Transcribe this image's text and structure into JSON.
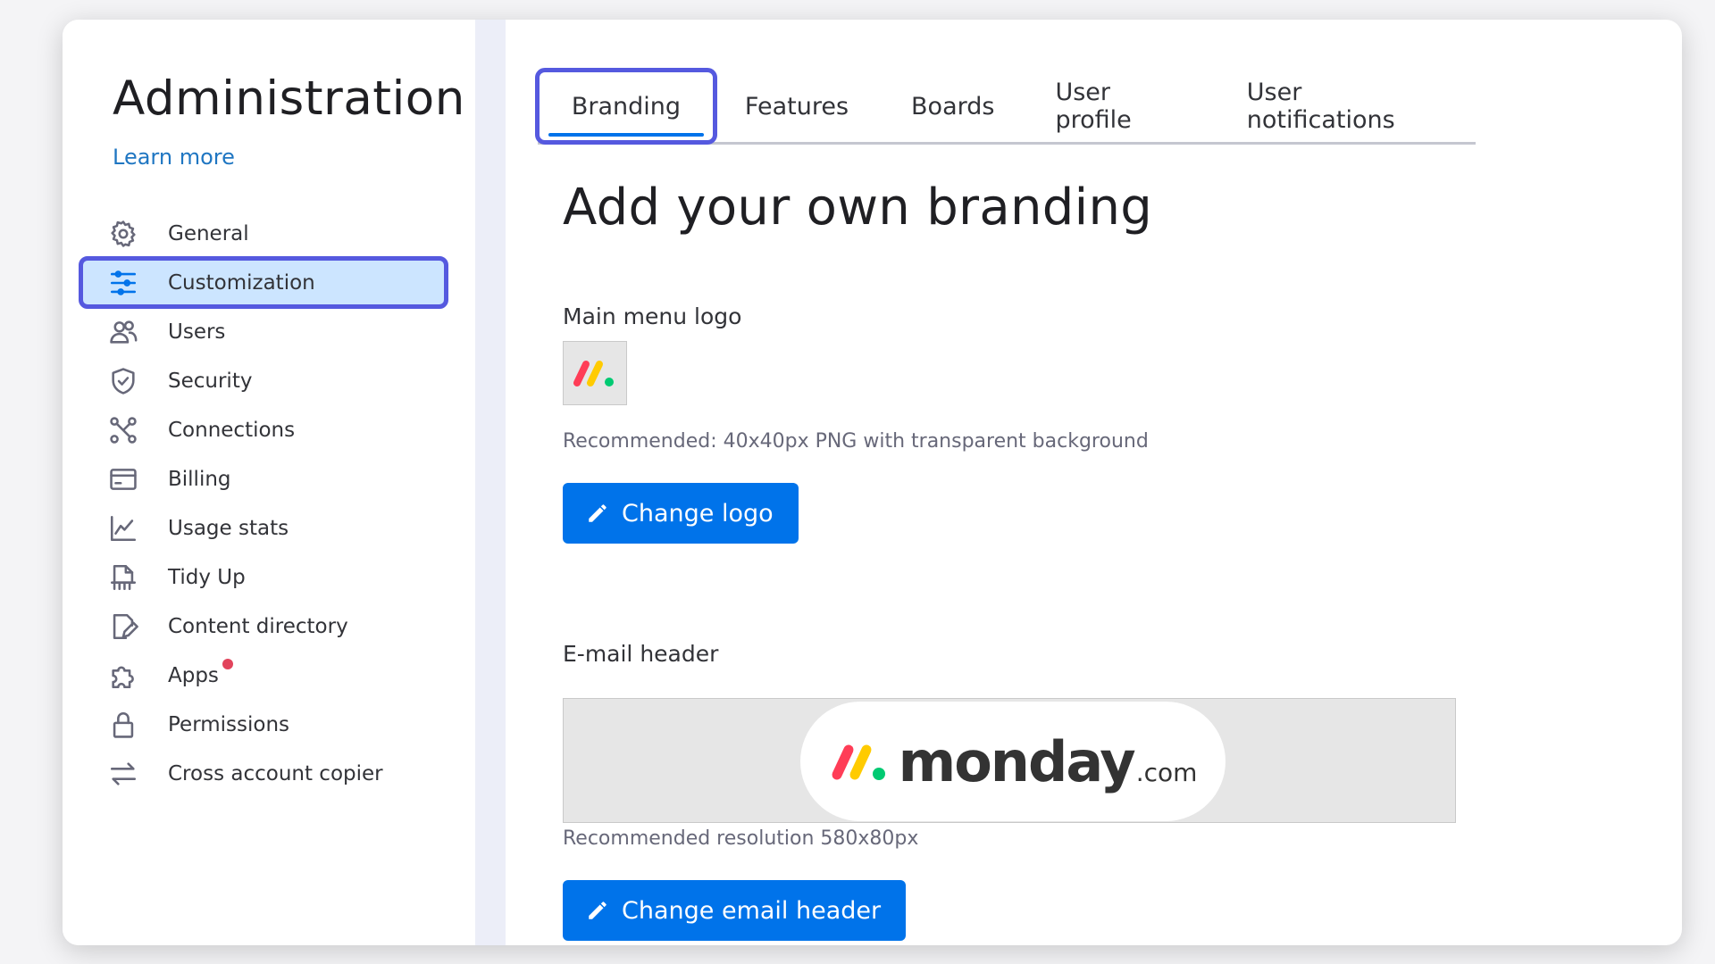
{
  "sidebar": {
    "title": "Administration",
    "learn_more": "Learn more",
    "items": [
      {
        "label": "General",
        "icon": "gear-icon"
      },
      {
        "label": "Customization",
        "icon": "sliders-icon",
        "active": true
      },
      {
        "label": "Users",
        "icon": "users-icon"
      },
      {
        "label": "Security",
        "icon": "shield-icon"
      },
      {
        "label": "Connections",
        "icon": "connections-icon"
      },
      {
        "label": "Billing",
        "icon": "credit-card-icon"
      },
      {
        "label": "Usage stats",
        "icon": "chart-icon"
      },
      {
        "label": "Tidy Up",
        "icon": "tidy-up-icon"
      },
      {
        "label": "Content directory",
        "icon": "content-directory-icon"
      },
      {
        "label": "Apps",
        "icon": "puzzle-icon",
        "notification_dot": true
      },
      {
        "label": "Permissions",
        "icon": "lock-icon"
      },
      {
        "label": "Cross account copier",
        "icon": "arrows-swap-icon"
      }
    ]
  },
  "tabs": [
    {
      "label": "Branding",
      "active": true
    },
    {
      "label": "Features"
    },
    {
      "label": "Boards"
    },
    {
      "label": "User profile"
    },
    {
      "label": "User notifications"
    }
  ],
  "main": {
    "title": "Add your own branding",
    "logo_section": {
      "label": "Main menu logo",
      "hint": "Recommended: 40x40px PNG with transparent background",
      "button": "Change logo"
    },
    "email_section": {
      "label": "E-mail header",
      "wordmark": "monday",
      "wordmark_suffix": ".com",
      "hint": "Recommended resolution 580x80px",
      "button": "Change email header"
    }
  },
  "colors": {
    "accent": "#0073ea",
    "highlight_outline": "#5559df",
    "active_bg": "#cce5ff",
    "logo_red": "#ff3d57",
    "logo_yellow": "#ffcb00",
    "logo_green": "#00ca72"
  }
}
